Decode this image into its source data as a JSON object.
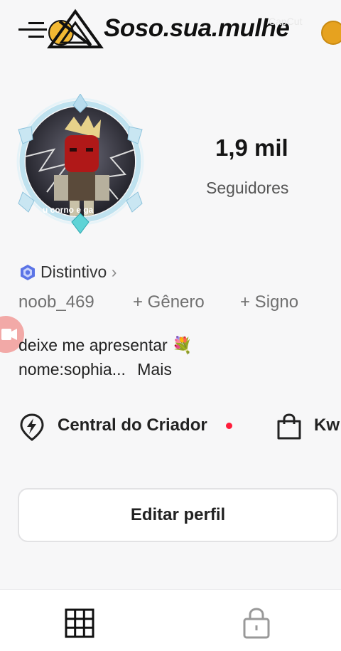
{
  "overlay": {
    "title": "Soso.sua.mulhe",
    "watermark": "CapCut"
  },
  "profile": {
    "avatar_caption": "u corno e ga",
    "followers_count": "1,9 mil",
    "followers_label": "Seguidores",
    "badge_label": "Distintivo",
    "badge_chevron": "›",
    "username": "noob_469",
    "add_gender": "+ Gênero",
    "add_sign": "+ Signo",
    "bio_line1": "deixe me apresentar 💐",
    "bio_line2_text": "nome:sophia...",
    "bio_more": "Mais"
  },
  "shortcuts": {
    "creator_center": "Central do Criador",
    "shop_label": "Kw"
  },
  "actions": {
    "edit_profile": "Editar perfil"
  },
  "tabs": [
    {
      "icon": "grid-icon"
    },
    {
      "icon": "lock-icon"
    }
  ],
  "colors": {
    "background": "#f7f7f8",
    "notification_dot": "#ff1d3b",
    "badge_blue": "#5b74e6",
    "record_button": "#f2a9a7"
  }
}
